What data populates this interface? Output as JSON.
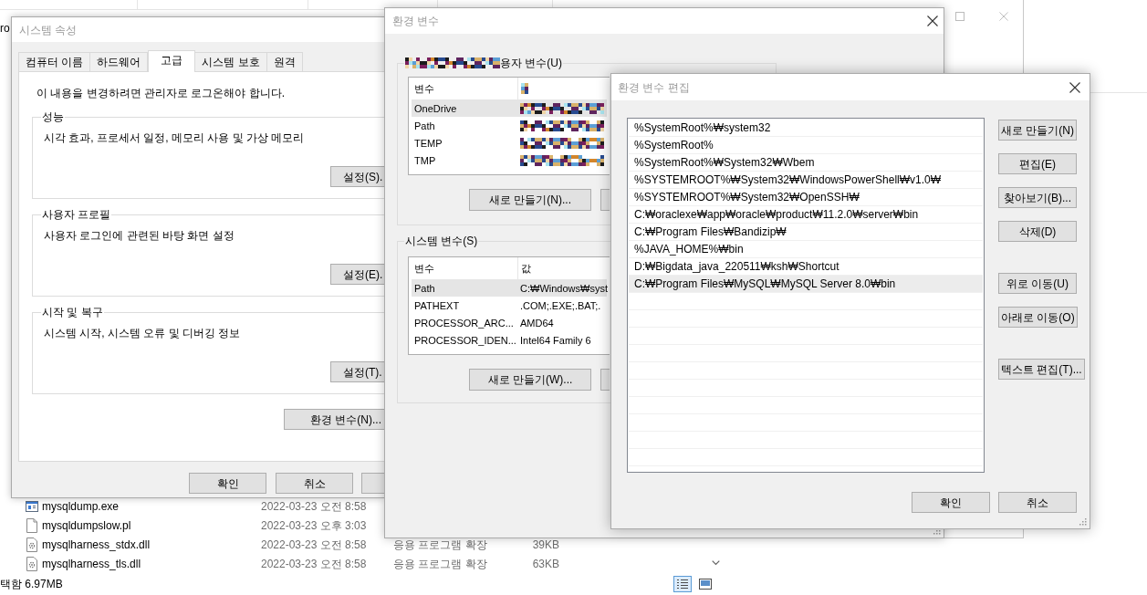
{
  "explorer": {
    "nav_items": [
      {
        "label": "ro"
      }
    ],
    "files": [
      {
        "kind": "exe",
        "name": "mysqldump.exe",
        "modified": "2022-03-23 오전 8:58"
      },
      {
        "kind": "file",
        "name": "mysqldumpslow.pl",
        "modified": "2022-03-23 오후 3:03"
      },
      {
        "kind": "dll",
        "name": "mysqlharness_stdx.dll",
        "modified": "2022-03-23 오전 8:58",
        "type": "응용 프로그램 확장",
        "size": "39KB"
      },
      {
        "kind": "dll",
        "name": "mysqlharness_tls.dll",
        "modified": "2022-03-23 오전 8:58",
        "type": "응용 프로그램 확장",
        "size": "63KB"
      }
    ],
    "status_bar": {
      "text": "택함 6.97MB"
    },
    "view_buttons": [
      {
        "kind": "details",
        "selected": true
      },
      {
        "kind": "thumbnails",
        "selected": false
      }
    ]
  },
  "system_properties": {
    "title": "시스템 속성",
    "tabs": [
      {
        "label": "컴퓨터 이름",
        "selected": false
      },
      {
        "label": "하드웨어",
        "selected": false
      },
      {
        "label": "고급",
        "selected": true
      },
      {
        "label": "시스템 보호",
        "selected": false
      },
      {
        "label": "원격",
        "selected": false
      }
    ],
    "notice": "이 내용을 변경하려면 관리자로 로그온해야 합니다.",
    "groups": [
      {
        "title": "성능",
        "description": "시각 효과, 프로세서 일정, 메모리 사용 및 가상 메모리",
        "button": "설정(S)."
      },
      {
        "title": "사용자 프로필",
        "description": "사용자 로그인에 관련된 바탕 화면 설정",
        "button": "설정(E)."
      },
      {
        "title": "시작 및 복구",
        "description": "시스템 시작, 시스템 오류 및 디버깅 정보",
        "button": "설정(T)."
      }
    ],
    "env_button": "환경 변수(N)...",
    "buttons": [
      {
        "kind": "full",
        "label": "확인"
      },
      {
        "kind": "full",
        "label": "취소"
      },
      {
        "kind": "cut"
      }
    ]
  },
  "environment_variables": {
    "title": "환경 변수",
    "user_variables": {
      "title": "용자 변수(U)",
      "title_redacted": true,
      "columns": [
        {
          "label": "변수"
        },
        {
          "redacted": true
        }
      ],
      "rows": [
        {
          "name": "OneDrive",
          "redacted": true,
          "selected": true
        },
        {
          "name": "Path",
          "redacted": true,
          "selected": false
        },
        {
          "name": "TEMP",
          "redacted": true,
          "selected": false
        },
        {
          "name": "TMP",
          "redacted": true,
          "selected": false
        }
      ],
      "buttons": [
        {
          "kind": "full",
          "label": "새로 만들기(N)..."
        },
        {
          "kind": "cut"
        }
      ]
    },
    "system_variables": {
      "title": "시스템 변수(S)",
      "columns": [
        {
          "label": "변수"
        },
        {
          "label": "값"
        }
      ],
      "rows": [
        {
          "name": "Path",
          "value": "C:₩Windows₩syst",
          "selected": true
        },
        {
          "name": "PATHEXT",
          "value": ".COM;.EXE;.BAT;.",
          "selected": false
        },
        {
          "name": "PROCESSOR_ARC...",
          "value": "AMD64",
          "selected": false
        },
        {
          "name": "PROCESSOR_IDEN...",
          "value": "Intel64 Family 6",
          "selected": false
        }
      ],
      "buttons": [
        {
          "kind": "full",
          "label": "새로 만들기(W)..."
        },
        {
          "kind": "cut"
        }
      ]
    }
  },
  "edit_dialog": {
    "title": "환경 변수 편집",
    "entries": [
      {
        "text": "%SystemRoot%₩system32",
        "selected": false
      },
      {
        "text": "%SystemRoot%",
        "selected": false
      },
      {
        "text": "%SystemRoot%₩System32₩Wbem",
        "selected": false
      },
      {
        "text": "%SYSTEMROOT%₩System32₩WindowsPowerShell₩v1.0₩",
        "selected": false
      },
      {
        "text": "%SYSTEMROOT%₩System32₩OpenSSH₩",
        "selected": false
      },
      {
        "text": "C:₩oraclexe₩app₩oracle₩product₩11.2.0₩server₩bin",
        "selected": false
      },
      {
        "text": "C:₩Program Files₩Bandizip₩",
        "selected": false
      },
      {
        "text": "%JAVA_HOME%₩bin",
        "selected": false
      },
      {
        "text": "D:₩Bigdata_java_220511₩ksh₩Shortcut",
        "selected": false
      },
      {
        "text": "C:₩Program Files₩MySQL₩MySQL Server 8.0₩bin",
        "selected": true
      }
    ],
    "side_button_groups": [
      {
        "buttons": [
          "새로 만들기(N)",
          "편집(E)",
          "찾아보기(B)...",
          "삭제(D)"
        ]
      },
      {
        "buttons": [
          "위로 이동(U)",
          "아래로 이동(O)"
        ]
      },
      {
        "buttons": [
          "텍스트 편집(T)..."
        ]
      }
    ],
    "buttons": [
      "확인",
      "취소"
    ]
  }
}
